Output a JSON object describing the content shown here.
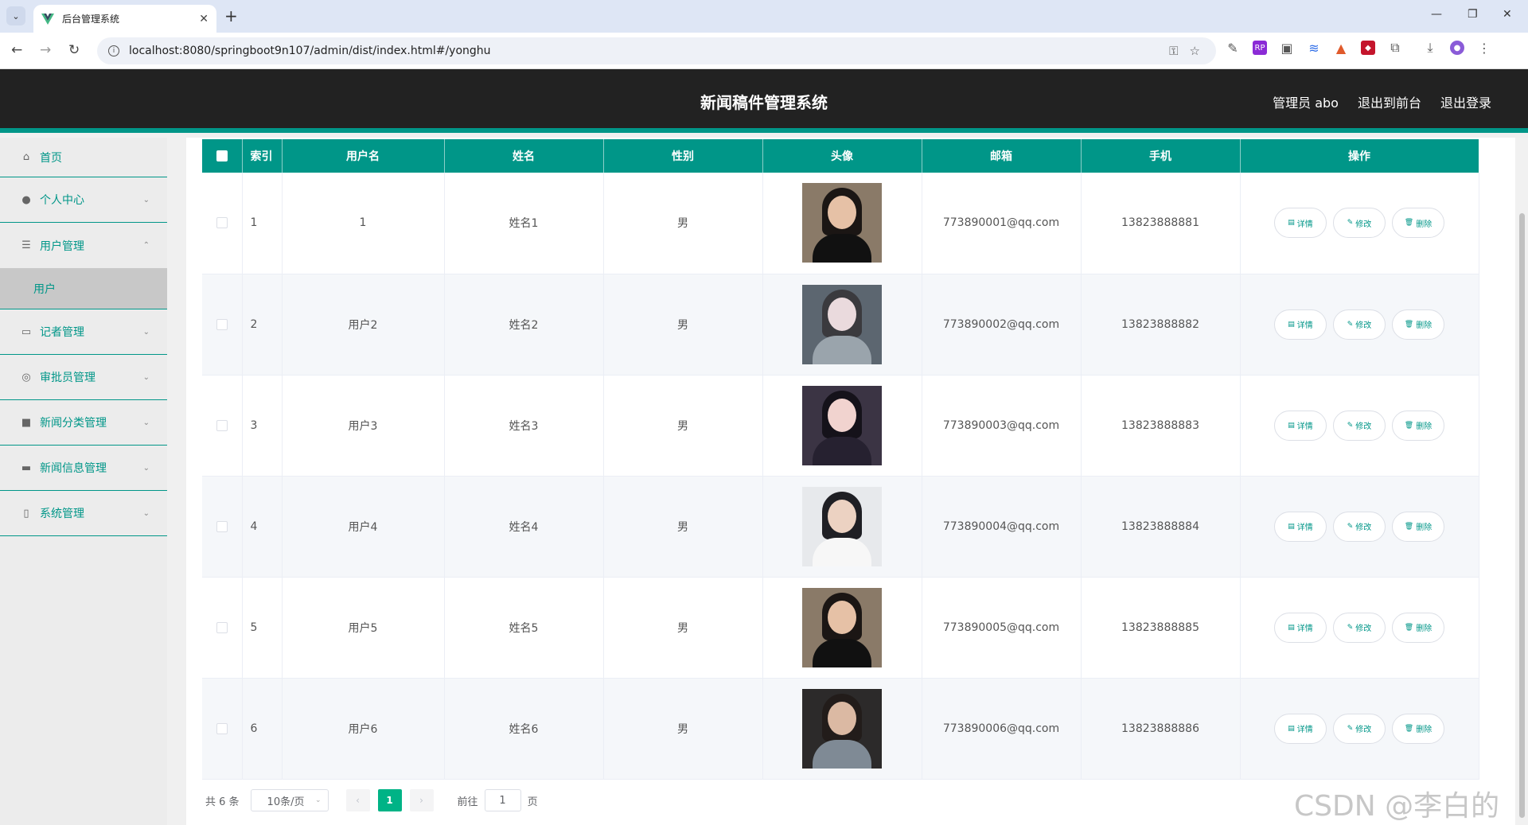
{
  "browser": {
    "tab_title": "后台管理系统",
    "url": "localhost:8080/springboot9n107/admin/dist/index.html#/yonghu"
  },
  "header": {
    "title": "新闻稿件管理系统",
    "links": [
      "管理员 abo",
      "退出到前台",
      "退出登录"
    ]
  },
  "sidebar": {
    "items": [
      {
        "label": "首页",
        "icon": "home-icon"
      },
      {
        "label": "个人中心",
        "icon": "user-icon"
      },
      {
        "label": "用户管理",
        "icon": "list-icon",
        "expanded": true,
        "sub": "用户"
      },
      {
        "label": "记者管理",
        "icon": "card-icon"
      },
      {
        "label": "审批员管理",
        "icon": "compass-icon"
      },
      {
        "label": "新闻分类管理",
        "icon": "briefcase-icon"
      },
      {
        "label": "新闻信息管理",
        "icon": "message-icon"
      },
      {
        "label": "系统管理",
        "icon": "phone-icon"
      }
    ]
  },
  "table": {
    "headers": [
      "索引",
      "用户名",
      "姓名",
      "性别",
      "头像",
      "邮箱",
      "手机",
      "操作"
    ],
    "rows": [
      {
        "index": "1",
        "username": "1",
        "name": "姓名1",
        "gender": "男",
        "email": "773890001@qq.com",
        "phone": "13823888881"
      },
      {
        "index": "2",
        "username": "用户2",
        "name": "姓名2",
        "gender": "男",
        "email": "773890002@qq.com",
        "phone": "13823888882"
      },
      {
        "index": "3",
        "username": "用户3",
        "name": "姓名3",
        "gender": "男",
        "email": "773890003@qq.com",
        "phone": "13823888883"
      },
      {
        "index": "4",
        "username": "用户4",
        "name": "姓名4",
        "gender": "男",
        "email": "773890004@qq.com",
        "phone": "13823888884"
      },
      {
        "index": "5",
        "username": "用户5",
        "name": "姓名5",
        "gender": "男",
        "email": "773890005@qq.com",
        "phone": "13823888885"
      },
      {
        "index": "6",
        "username": "用户6",
        "name": "姓名6",
        "gender": "男",
        "email": "773890006@qq.com",
        "phone": "13823888886"
      }
    ],
    "actions": {
      "detail": "详情",
      "edit": "修改",
      "delete": "删除"
    }
  },
  "pagination": {
    "total": "共 6 条",
    "page_size": "10条/页",
    "current_page": "1",
    "goto_prefix": "前往",
    "goto_value": "1",
    "goto_suffix": "页"
  },
  "watermark": "CSDN @李白的粉",
  "colors": {
    "accent": "#009688",
    "header_bg": "#222222",
    "active_page": "#00b386"
  }
}
